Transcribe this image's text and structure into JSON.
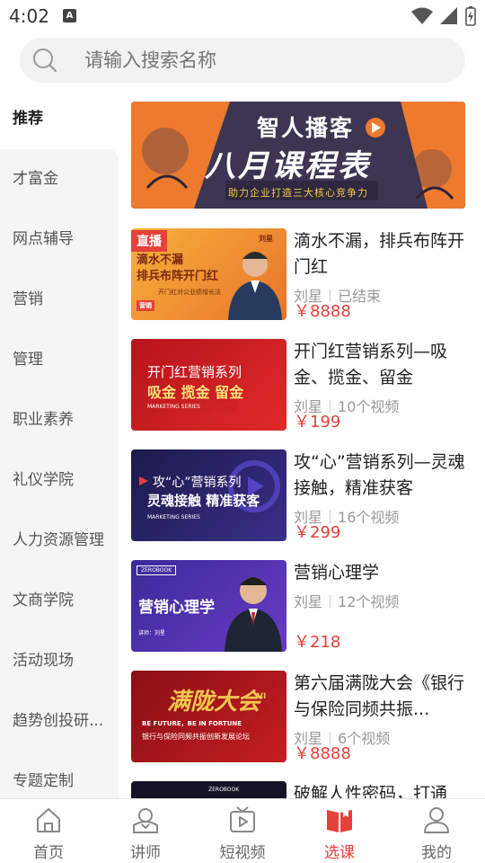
{
  "status_bar": {
    "time": "4:02",
    "app_badge": "A"
  },
  "search": {
    "placeholder": "请输入搜索名称"
  },
  "sidebar": {
    "items": [
      {
        "label": "推荐",
        "active": true
      },
      {
        "label": "才富金"
      },
      {
        "label": "网点辅导"
      },
      {
        "label": "营销"
      },
      {
        "label": "管理"
      },
      {
        "label": "职业素养"
      },
      {
        "label": "礼仪学院"
      },
      {
        "label": "人力资源管理"
      },
      {
        "label": "文商学院"
      },
      {
        "label": "活动现场"
      },
      {
        "label": "趋势创投研..."
      },
      {
        "label": "专题定制"
      }
    ]
  },
  "banner": {
    "title1": "智人播客",
    "title2": "八月课程表",
    "subtitle": "助力企业打造三大核心竞争力"
  },
  "courses": [
    {
      "title": "滴水不漏，排兵布阵开门红",
      "author": "刘星",
      "info": "已结束",
      "price": "￥8888",
      "thumb": {
        "badge": "直播",
        "line1": "滴水不漏",
        "line2": "排兵布阵开门红",
        "line3": "开门红对公业绩增长法",
        "tag": "营销",
        "person": "刘星"
      }
    },
    {
      "title": "开门红营销系列—吸金、揽金、留金",
      "author": "刘星",
      "info": "10个视频",
      "price": "￥199",
      "thumb": {
        "line1": "开门红营销系列",
        "line2": "吸金  揽金  留金",
        "line3": "MARKETING SERIES"
      }
    },
    {
      "title": "攻“心”营销系列—灵魂接触，精准获客",
      "author": "刘星",
      "info": "16个视频",
      "price": "￥299",
      "thumb": {
        "line1": "攻“心”营销系列",
        "line2": "灵魂接触  精准获客",
        "line3": "MARKETING SERIES"
      }
    },
    {
      "title": "营销心理学",
      "author": "刘星",
      "info": "12个视频",
      "price": "￥218",
      "thumb": {
        "line1": "营销心理学",
        "line2": "讲师：刘星",
        "brand": "ZEROBOOK"
      }
    },
    {
      "title": "第六届满陇大会《银行与保险同频共振...",
      "author": "刘星",
      "info": "6个视频",
      "price": "￥8888",
      "thumb": {
        "line1": "满陇大会",
        "line2": "BE FUTURE，BE IN FORTUNE",
        "line3": "银行与保险同频共振创新发展论坛",
        "roman": "VI"
      }
    },
    {
      "title": "破解人性密码，打通",
      "thumb": {
        "brand": "ZEROBOOK"
      }
    }
  ],
  "bottom_nav": {
    "items": [
      {
        "label": "首页",
        "icon": "home-icon"
      },
      {
        "label": "讲师",
        "icon": "lecturer-icon"
      },
      {
        "label": "短视频",
        "icon": "short-video-icon"
      },
      {
        "label": "选课",
        "icon": "course-select-icon",
        "active": true
      },
      {
        "label": "我的",
        "icon": "profile-icon"
      }
    ]
  },
  "colors": {
    "accent": "#e5403a",
    "sidebar_bg": "#f5f5f5",
    "price": "#e5403a"
  }
}
